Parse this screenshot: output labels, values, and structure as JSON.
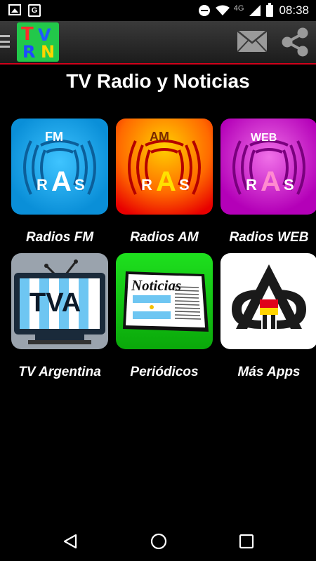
{
  "status_bar": {
    "time": "08:38",
    "network": "4G"
  },
  "app_bar": {
    "logo_letters": [
      "T",
      "V",
      "R",
      "N"
    ],
    "mail_icon": "mail-icon",
    "share_icon": "share-icon"
  },
  "page": {
    "title": "TV Radio y Noticias"
  },
  "tiles": [
    {
      "label": "Radios FM",
      "badge": "FM",
      "ras": [
        "R",
        "A",
        "S"
      ],
      "color": "#1aa6e8"
    },
    {
      "label": "Radios AM",
      "badge": "AM",
      "ras": [
        "R",
        "A",
        "S"
      ],
      "color": "#f4a100"
    },
    {
      "label": "Radios WEB",
      "badge": "WEB",
      "ras": [
        "R",
        "A",
        "S"
      ],
      "color": "#c21bb0"
    },
    {
      "label": "TV Argentina",
      "badge": "TVA"
    },
    {
      "label": "Periódicos",
      "badge": "Noticias"
    },
    {
      "label": "Más Apps"
    }
  ],
  "colors": {
    "accent_red": "#d0021b",
    "logo_green": "#22c84a",
    "tile_green": "#14c814"
  }
}
